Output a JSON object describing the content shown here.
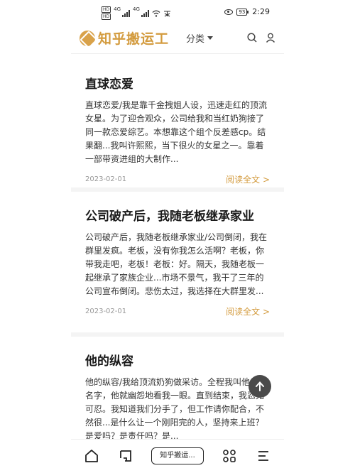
{
  "status_bar": {
    "sim1": "HD",
    "sim2": "HD",
    "net1": "4G",
    "net2": "4G",
    "battery": "93",
    "time": "2:29"
  },
  "header": {
    "logo_text": "知乎搬运工",
    "category_label": "分类"
  },
  "articles": [
    {
      "title": "直球恋爱",
      "excerpt": "直球恋爱/我是靠千金拽姐人设，迅速走红的顶流女星。为了迎合观众，公司给我和当红奶狗接了同一款恋爱综艺。本想靠这个组个反差感cp。结果翻...我叫许熙熙，当下很火的女星之一。靠着一部带资进组的大制作...",
      "date": "2023-02-01",
      "read_more": "阅读全文 >"
    },
    {
      "title": "公司破产后，我随老板继承家业",
      "excerpt": "公司破产后，我随老板继承家业/公司倒闭，我在群里发疯。老板，没有你我怎么活啊？老板，你带我走吧，老板！老板：好。隔天，我随老板一起继承了家族企业...市场不景气，我干了三年的公司宣布倒闭。悲伤太过，我选择在大群里发...",
      "date": "2023-02-01",
      "read_more": "阅读全文 >"
    },
    {
      "title": "他的纵容",
      "excerpt": "他的纵容/我给顶流奶狗做采访。全程我叫他一次名字，他就幽怨地看我一眼。直到结束，我忍无可忍。我知道我们分手了，但工作请你配合，不然很...是什么让一个刚阳完的人，坚持来上班？是爱吗？是责任吗？是..."
    }
  ],
  "bottom_bar": {
    "tab_label": "知乎搬运..."
  },
  "colors": {
    "accent": "#d39b3e",
    "divider": "#f4f4f4"
  }
}
